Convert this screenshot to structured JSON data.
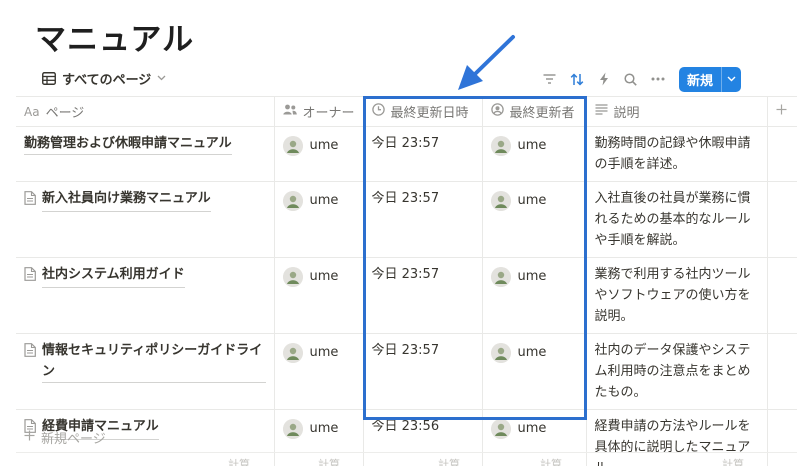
{
  "page": {
    "title": "マニュアル"
  },
  "view": {
    "label": "すべてのページ"
  },
  "toolbar": {
    "new_label": "新規"
  },
  "columns": [
    {
      "label": "ページ",
      "icon": "text-property-icon"
    },
    {
      "label": "オーナー",
      "icon": "person-property-icon"
    },
    {
      "label": "最終更新日時",
      "icon": "clock-icon"
    },
    {
      "label": "最終更新者",
      "icon": "user-circle-icon"
    },
    {
      "label": "説明",
      "icon": "text-lines-icon"
    }
  ],
  "rows": [
    {
      "name": "勤務管理および休暇申請マニュアル",
      "owner": "ume",
      "updated": "今日 23:57",
      "updated_by": "ume",
      "description": "勤務時間の記録や休暇申請の手順を詳述。"
    },
    {
      "name": "新入社員向け業務マニュアル",
      "owner": "ume",
      "updated": "今日 23:57",
      "updated_by": "ume",
      "description": "入社直後の社員が業務に慣れるための基本的なルールや手順を解説。"
    },
    {
      "name": "社内システム利用ガイド",
      "owner": "ume",
      "updated": "今日 23:57",
      "updated_by": "ume",
      "description": "業務で利用する社内ツールやソフトウェアの使い方を説明。"
    },
    {
      "name": "情報セキュリティポリシーガイドライン",
      "owner": "ume",
      "updated": "今日 23:57",
      "updated_by": "ume",
      "description": "社内のデータ保護やシステム利用時の注意点をまとめたもの。"
    },
    {
      "name": "経費申請マニュアル",
      "owner": "ume",
      "updated": "今日 23:56",
      "updated_by": "ume",
      "description": "経費申請の方法やルールを具体的に説明したマニュアル。"
    }
  ],
  "add_row": {
    "label": "新規ページ"
  },
  "calculate": {
    "label": "計算"
  }
}
